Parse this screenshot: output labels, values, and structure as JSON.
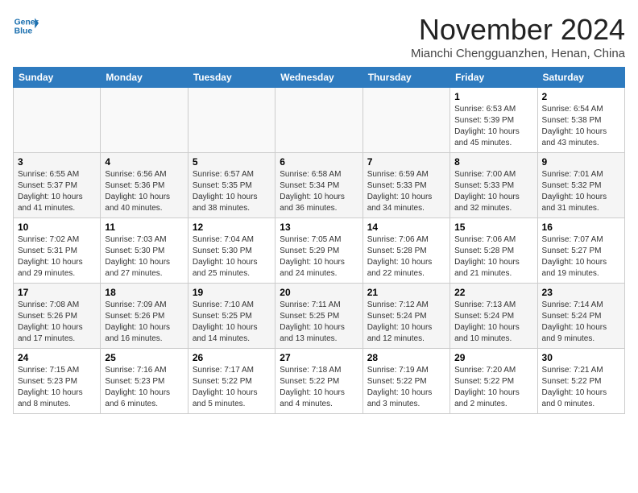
{
  "header": {
    "logo_line1": "General",
    "logo_line2": "Blue",
    "month": "November 2024",
    "location": "Mianchi Chengguanzhen, Henan, China"
  },
  "weekdays": [
    "Sunday",
    "Monday",
    "Tuesday",
    "Wednesday",
    "Thursday",
    "Friday",
    "Saturday"
  ],
  "weeks": [
    [
      {
        "day": "",
        "info": ""
      },
      {
        "day": "",
        "info": ""
      },
      {
        "day": "",
        "info": ""
      },
      {
        "day": "",
        "info": ""
      },
      {
        "day": "",
        "info": ""
      },
      {
        "day": "1",
        "info": "Sunrise: 6:53 AM\nSunset: 5:39 PM\nDaylight: 10 hours\nand 45 minutes."
      },
      {
        "day": "2",
        "info": "Sunrise: 6:54 AM\nSunset: 5:38 PM\nDaylight: 10 hours\nand 43 minutes."
      }
    ],
    [
      {
        "day": "3",
        "info": "Sunrise: 6:55 AM\nSunset: 5:37 PM\nDaylight: 10 hours\nand 41 minutes."
      },
      {
        "day": "4",
        "info": "Sunrise: 6:56 AM\nSunset: 5:36 PM\nDaylight: 10 hours\nand 40 minutes."
      },
      {
        "day": "5",
        "info": "Sunrise: 6:57 AM\nSunset: 5:35 PM\nDaylight: 10 hours\nand 38 minutes."
      },
      {
        "day": "6",
        "info": "Sunrise: 6:58 AM\nSunset: 5:34 PM\nDaylight: 10 hours\nand 36 minutes."
      },
      {
        "day": "7",
        "info": "Sunrise: 6:59 AM\nSunset: 5:33 PM\nDaylight: 10 hours\nand 34 minutes."
      },
      {
        "day": "8",
        "info": "Sunrise: 7:00 AM\nSunset: 5:33 PM\nDaylight: 10 hours\nand 32 minutes."
      },
      {
        "day": "9",
        "info": "Sunrise: 7:01 AM\nSunset: 5:32 PM\nDaylight: 10 hours\nand 31 minutes."
      }
    ],
    [
      {
        "day": "10",
        "info": "Sunrise: 7:02 AM\nSunset: 5:31 PM\nDaylight: 10 hours\nand 29 minutes."
      },
      {
        "day": "11",
        "info": "Sunrise: 7:03 AM\nSunset: 5:30 PM\nDaylight: 10 hours\nand 27 minutes."
      },
      {
        "day": "12",
        "info": "Sunrise: 7:04 AM\nSunset: 5:30 PM\nDaylight: 10 hours\nand 25 minutes."
      },
      {
        "day": "13",
        "info": "Sunrise: 7:05 AM\nSunset: 5:29 PM\nDaylight: 10 hours\nand 24 minutes."
      },
      {
        "day": "14",
        "info": "Sunrise: 7:06 AM\nSunset: 5:28 PM\nDaylight: 10 hours\nand 22 minutes."
      },
      {
        "day": "15",
        "info": "Sunrise: 7:06 AM\nSunset: 5:28 PM\nDaylight: 10 hours\nand 21 minutes."
      },
      {
        "day": "16",
        "info": "Sunrise: 7:07 AM\nSunset: 5:27 PM\nDaylight: 10 hours\nand 19 minutes."
      }
    ],
    [
      {
        "day": "17",
        "info": "Sunrise: 7:08 AM\nSunset: 5:26 PM\nDaylight: 10 hours\nand 17 minutes."
      },
      {
        "day": "18",
        "info": "Sunrise: 7:09 AM\nSunset: 5:26 PM\nDaylight: 10 hours\nand 16 minutes."
      },
      {
        "day": "19",
        "info": "Sunrise: 7:10 AM\nSunset: 5:25 PM\nDaylight: 10 hours\nand 14 minutes."
      },
      {
        "day": "20",
        "info": "Sunrise: 7:11 AM\nSunset: 5:25 PM\nDaylight: 10 hours\nand 13 minutes."
      },
      {
        "day": "21",
        "info": "Sunrise: 7:12 AM\nSunset: 5:24 PM\nDaylight: 10 hours\nand 12 minutes."
      },
      {
        "day": "22",
        "info": "Sunrise: 7:13 AM\nSunset: 5:24 PM\nDaylight: 10 hours\nand 10 minutes."
      },
      {
        "day": "23",
        "info": "Sunrise: 7:14 AM\nSunset: 5:24 PM\nDaylight: 10 hours\nand 9 minutes."
      }
    ],
    [
      {
        "day": "24",
        "info": "Sunrise: 7:15 AM\nSunset: 5:23 PM\nDaylight: 10 hours\nand 8 minutes."
      },
      {
        "day": "25",
        "info": "Sunrise: 7:16 AM\nSunset: 5:23 PM\nDaylight: 10 hours\nand 6 minutes."
      },
      {
        "day": "26",
        "info": "Sunrise: 7:17 AM\nSunset: 5:22 PM\nDaylight: 10 hours\nand 5 minutes."
      },
      {
        "day": "27",
        "info": "Sunrise: 7:18 AM\nSunset: 5:22 PM\nDaylight: 10 hours\nand 4 minutes."
      },
      {
        "day": "28",
        "info": "Sunrise: 7:19 AM\nSunset: 5:22 PM\nDaylight: 10 hours\nand 3 minutes."
      },
      {
        "day": "29",
        "info": "Sunrise: 7:20 AM\nSunset: 5:22 PM\nDaylight: 10 hours\nand 2 minutes."
      },
      {
        "day": "30",
        "info": "Sunrise: 7:21 AM\nSunset: 5:22 PM\nDaylight: 10 hours\nand 0 minutes."
      }
    ]
  ]
}
